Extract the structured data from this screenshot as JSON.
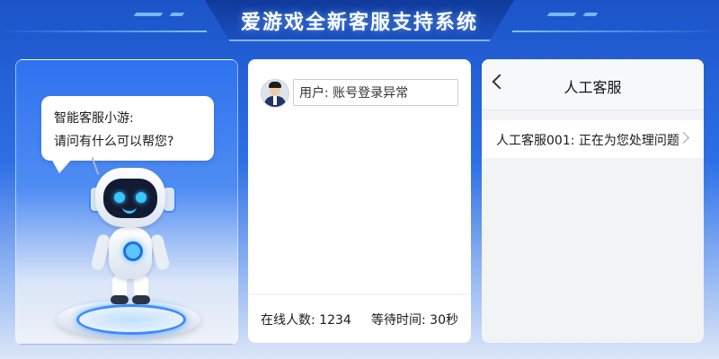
{
  "header": {
    "title": "爱游戏全新客服支持系统"
  },
  "bot_panel": {
    "greeting_line1": "智能客服小游:",
    "greeting_line2": "请问有什么可以帮您?"
  },
  "user_panel": {
    "input_value": "用户: 账号登录异常",
    "online_label": "在线人数: 1234",
    "wait_label": "等待时间: 30秒"
  },
  "agent_panel": {
    "title": "人工客服",
    "agent_status": "人工客服001: 正在为您处理问题"
  },
  "colors": {
    "accent": "#2d6fe6",
    "header_bar": "#0f3a9a"
  },
  "icons": [
    "robot-illustration",
    "user-avatar-icon",
    "back-arrow-icon",
    "chevron-right-icon"
  ]
}
